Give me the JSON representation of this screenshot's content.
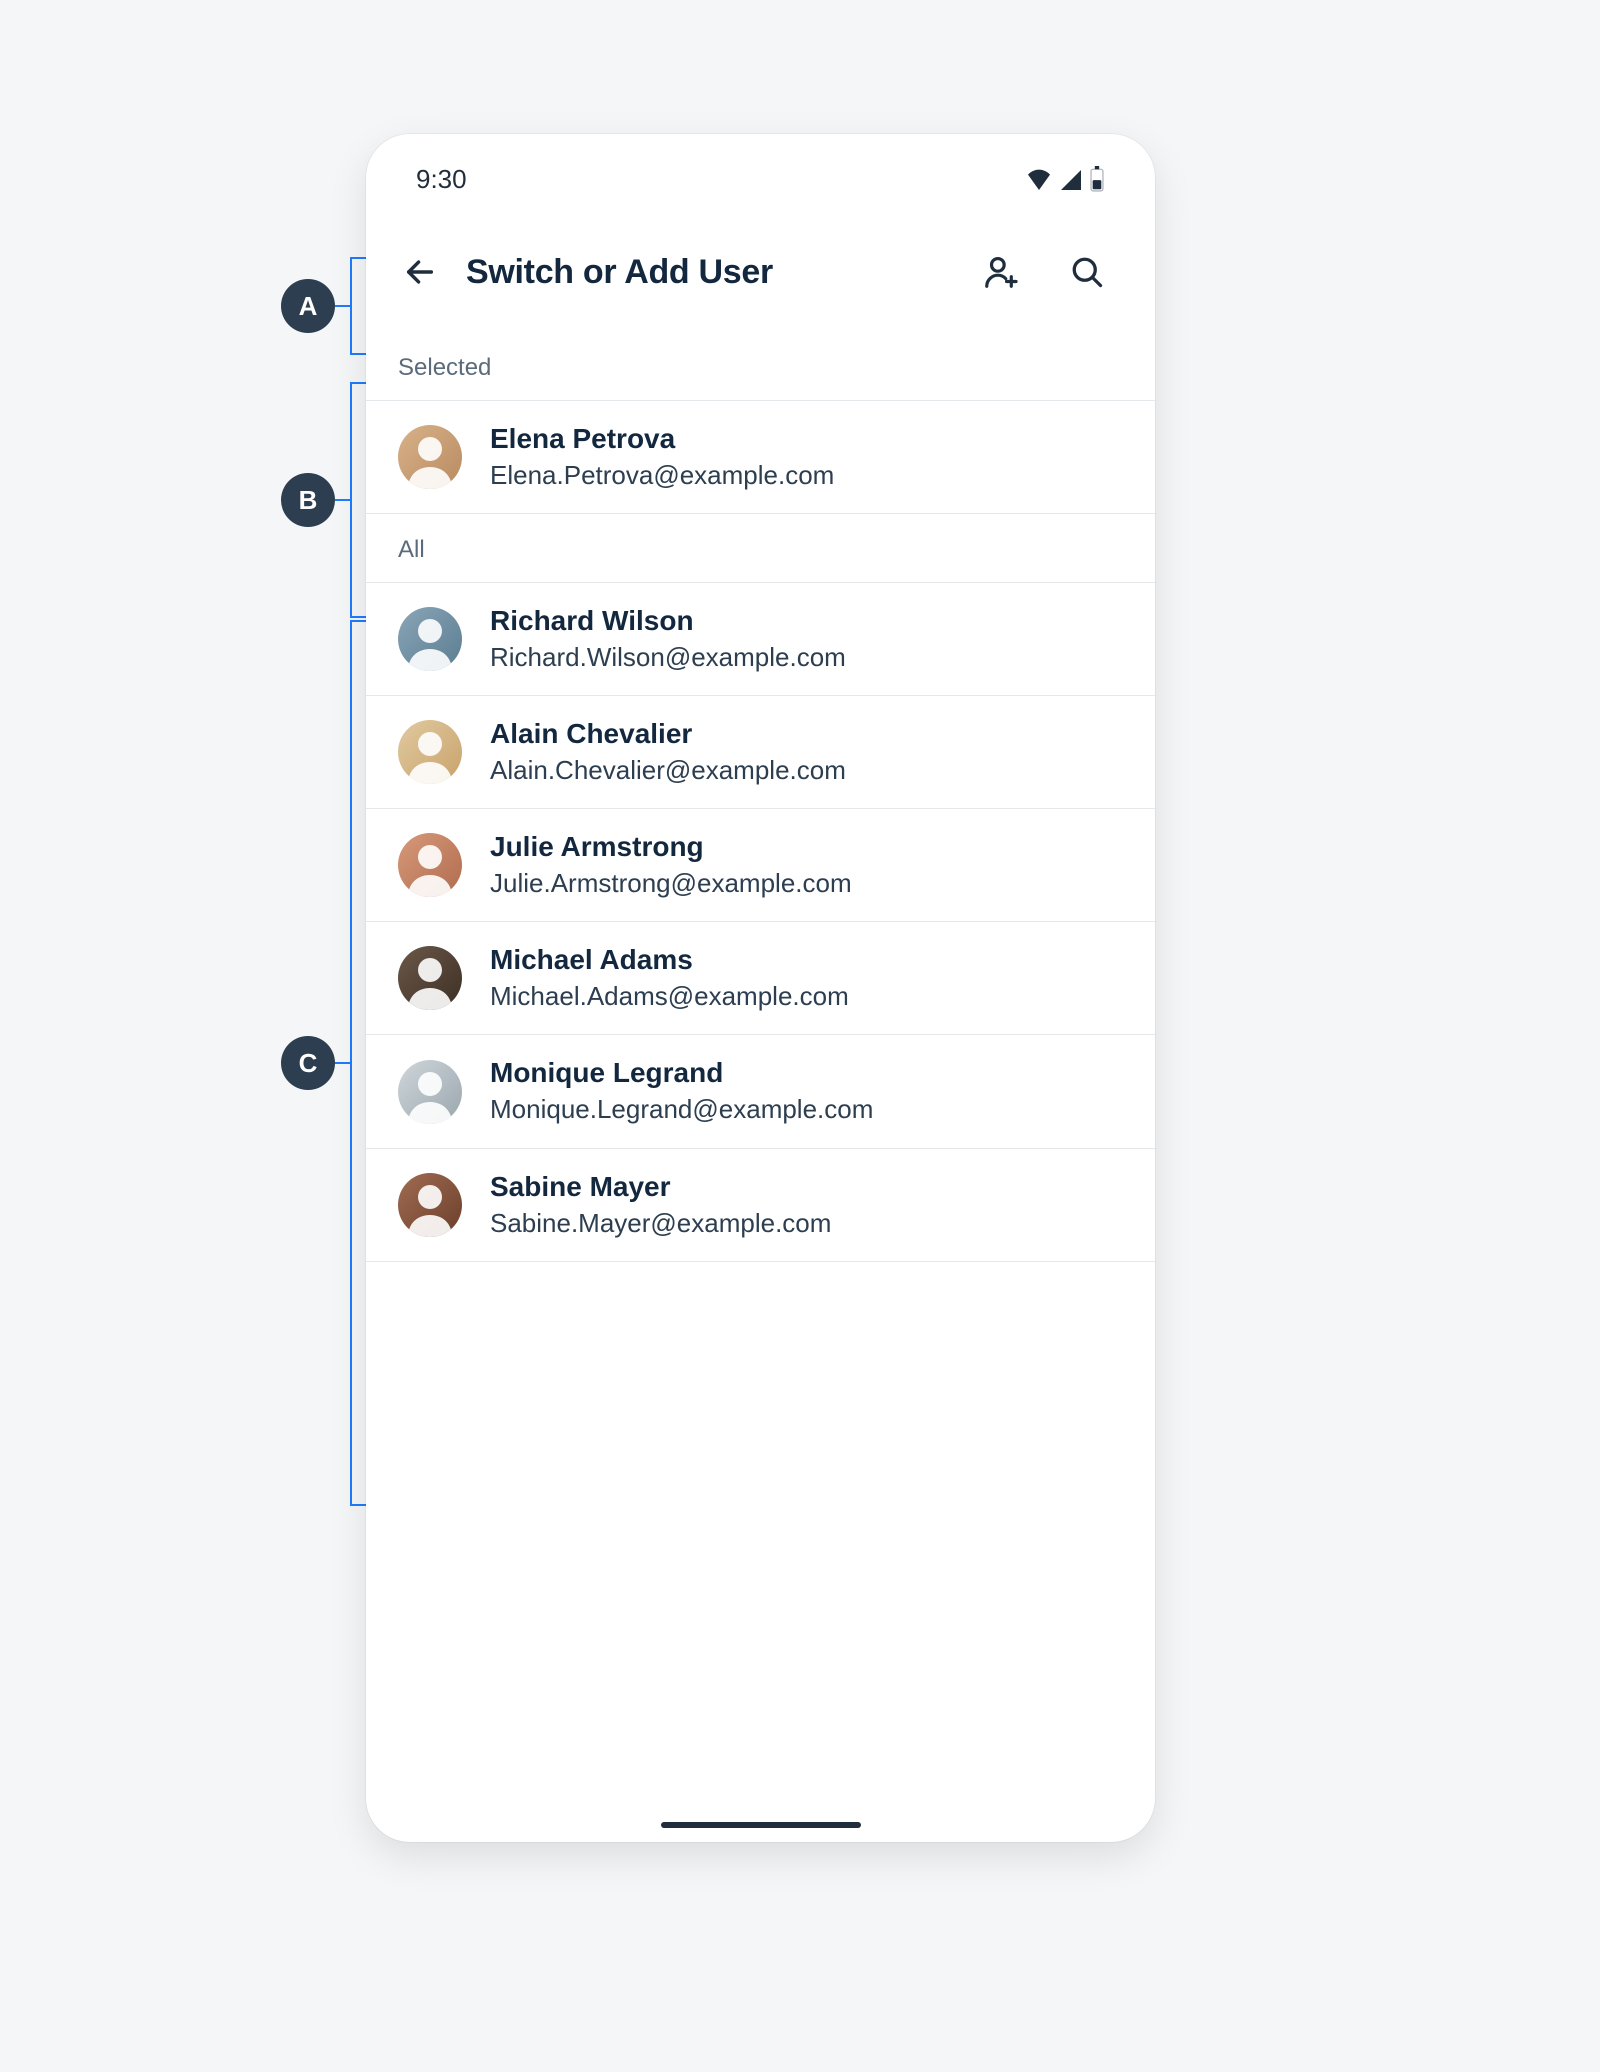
{
  "status": {
    "time": "9:30"
  },
  "header": {
    "title": "Switch or Add User"
  },
  "sections": {
    "selected": {
      "label": "Selected",
      "items": [
        {
          "name": "Elena Petrova",
          "email": "Elena.Petrova@example.com"
        }
      ]
    },
    "all": {
      "label": "All",
      "items": [
        {
          "name": "Richard Wilson",
          "email": "Richard.Wilson@example.com"
        },
        {
          "name": "Alain Chevalier",
          "email": "Alain.Chevalier@example.com"
        },
        {
          "name": "Julie Armstrong",
          "email": "Julie.Armstrong@example.com"
        },
        {
          "name": "Michael Adams",
          "email": "Michael.Adams@example.com"
        },
        {
          "name": "Monique Legrand",
          "email": "Monique.Legrand@example.com"
        },
        {
          "name": "Sabine Mayer",
          "email": "Sabine.Mayer@example.com"
        }
      ]
    }
  },
  "annotations": {
    "a": "A",
    "b": "B",
    "c": "C"
  },
  "icons": {
    "back": "arrow-left-icon",
    "add_user": "add-user-icon",
    "search": "search-icon",
    "wifi": "wifi-icon",
    "signal": "signal-icon",
    "battery": "battery-icon"
  }
}
